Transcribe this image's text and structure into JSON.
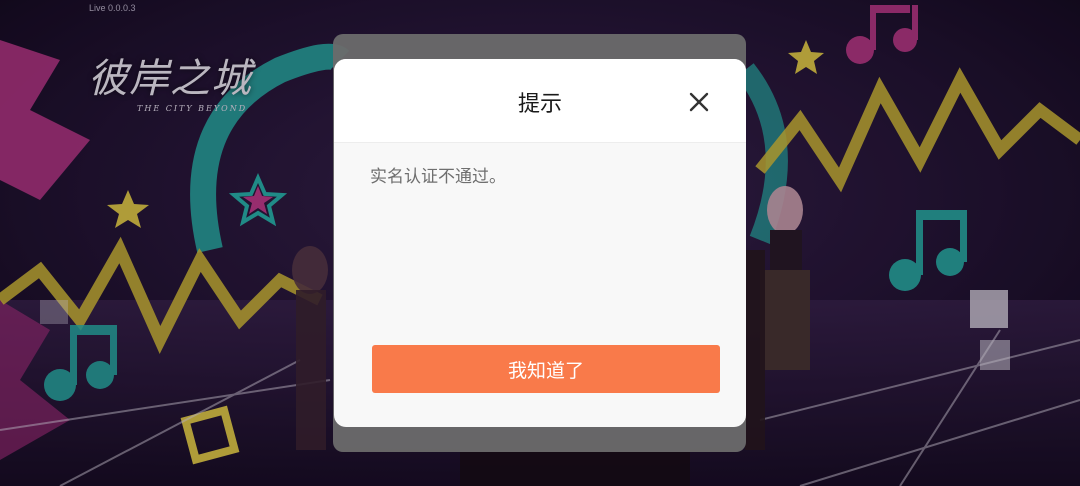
{
  "app": {
    "version": "Live 0.0.0.3",
    "logo_title": "彼岸之城",
    "logo_subtitle": "THE CITY BEYOND"
  },
  "dialog": {
    "title": "提示",
    "message": "实名认证不通过。",
    "confirm_label": "我知道了",
    "close_icon": "close-icon"
  },
  "colors": {
    "confirm_button": "#f97a4a",
    "dialog_bg": "#f8f8f8",
    "header_bg": "#ffffff",
    "back_panel": "#6b6b6b"
  }
}
